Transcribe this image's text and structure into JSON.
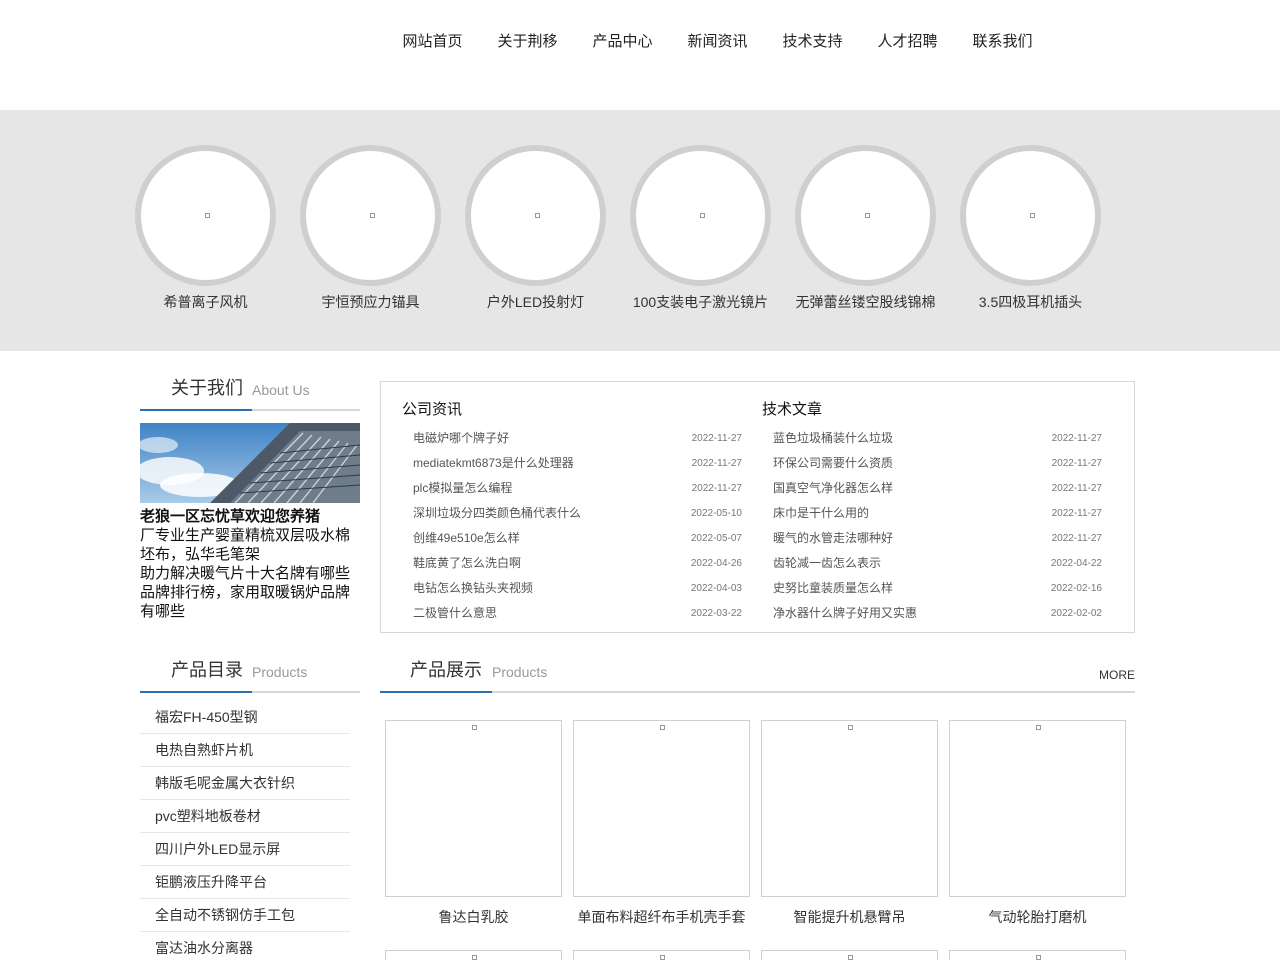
{
  "nav": [
    "网站首页",
    "关于荆移",
    "产品中心",
    "新闻资讯",
    "技术支持",
    "人才招聘",
    "联系我们"
  ],
  "banner": [
    "希普离子风机",
    "宇恒预应力锚具",
    "户外LED投射灯",
    "100支装电子激光镜片",
    "无弹蕾丝镂空股线锦棉",
    "3.5四极耳机插头"
  ],
  "about": {
    "title_cn": "关于我们",
    "title_en": "About Us",
    "line1": "老狼一区忘忧草欢迎您养猪",
    "line2": "厂专业生产婴童精梳双层吸水棉坯布，弘华毛笔架",
    "line3": "助力解决暖气片十大名牌有哪些品牌排行榜，家用取暖锅炉品牌有哪些"
  },
  "news": {
    "left_title": "公司资讯",
    "left": [
      {
        "t": "电磁炉哪个牌子好",
        "d": "2022-11-27"
      },
      {
        "t": "mediatekmt6873是什么处理器",
        "d": "2022-11-27"
      },
      {
        "t": "plc模拟量怎么编程",
        "d": "2022-11-27"
      },
      {
        "t": "深圳垃圾分四类颜色桶代表什么",
        "d": "2022-05-10"
      },
      {
        "t": "创维49e510e怎么样",
        "d": "2022-05-07"
      },
      {
        "t": "鞋底黄了怎么洗白啊",
        "d": "2022-04-26"
      },
      {
        "t": "电钻怎么换钻头夹视频",
        "d": "2022-04-03"
      },
      {
        "t": "二极管什么意思",
        "d": "2022-03-22"
      }
    ],
    "right_title": "技术文章",
    "right": [
      {
        "t": "蓝色垃圾桶装什么垃圾",
        "d": "2022-11-27"
      },
      {
        "t": "环保公司需要什么资质",
        "d": "2022-11-27"
      },
      {
        "t": "国真空气净化器怎么样",
        "d": "2022-11-27"
      },
      {
        "t": "床巾是干什么用的",
        "d": "2022-11-27"
      },
      {
        "t": "暖气的水管走法哪种好",
        "d": "2022-11-27"
      },
      {
        "t": "齿轮减一齿怎么表示",
        "d": "2022-04-22"
      },
      {
        "t": "史努比童装质量怎么样",
        "d": "2022-02-16"
      },
      {
        "t": "净水器什么牌子好用又实惠",
        "d": "2022-02-02"
      }
    ]
  },
  "catalog": {
    "title_cn": "产品目录",
    "title_en": "Products",
    "items": [
      "福宏FH-450型钢",
      "电热自熟虾片机",
      "韩版毛呢金属大衣针织",
      "pvc塑料地板卷材",
      "四川户外LED显示屏",
      "钜鹏液压升降平台",
      "全自动不锈钢仿手工包",
      "富达油水分离器"
    ]
  },
  "products": {
    "title_cn": "产品展示",
    "title_en": "Products",
    "more": "MORE",
    "items": [
      "鲁达白乳胶",
      "单面布料超纤布手机壳手套",
      "智能提升机悬臂吊",
      "气动轮胎打磨机"
    ]
  }
}
